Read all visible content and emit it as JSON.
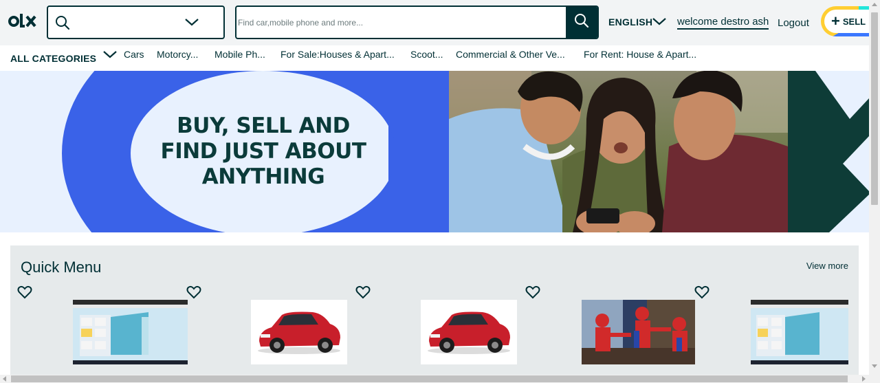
{
  "colors": {
    "brand_dark": "#002f34",
    "header_bg": "#f2f4f5",
    "banner_blue": "#3a62e8",
    "banner_light": "#e8f1fe",
    "quick_bg": "#e6eaeb"
  },
  "header": {
    "logo_icon": "olx-logo",
    "location_search_icon": "search-icon",
    "location_dropdown_icon": "chevron-down-icon",
    "search": {
      "placeholder": "Find car,mobile phone and more...",
      "value": ""
    },
    "search_button_icon": "search-icon",
    "language": "ENGLISH",
    "welcome": "welcome destro ash",
    "logout": "Logout",
    "sell_label": "SELL",
    "sell_icon": "plus-icon"
  },
  "categories": {
    "all_label": "ALL CATEGORIES",
    "items": [
      "Cars",
      "Motorcy...",
      "Mobile Ph...",
      "For Sale:Houses & Apart...",
      "Scoot...",
      "Commercial & Other Ve...",
      "For Rent: House & Apart..."
    ]
  },
  "banner": {
    "headline_lines": [
      "BUY, SELL AND",
      "FIND JUST ABOUT",
      "ANYTHING"
    ]
  },
  "quick_menu": {
    "title": "Quick Menu",
    "view_more": "View more",
    "items": [
      {
        "image": "app-screenshot",
        "icon": "heart-icon"
      },
      {
        "image": "red-hatchback-car",
        "icon": "heart-icon"
      },
      {
        "image": "red-hatchback-car",
        "icon": "heart-icon"
      },
      {
        "image": "spiderman-meme",
        "icon": "heart-icon"
      },
      {
        "image": "app-screenshot",
        "icon": "heart-icon"
      }
    ]
  }
}
